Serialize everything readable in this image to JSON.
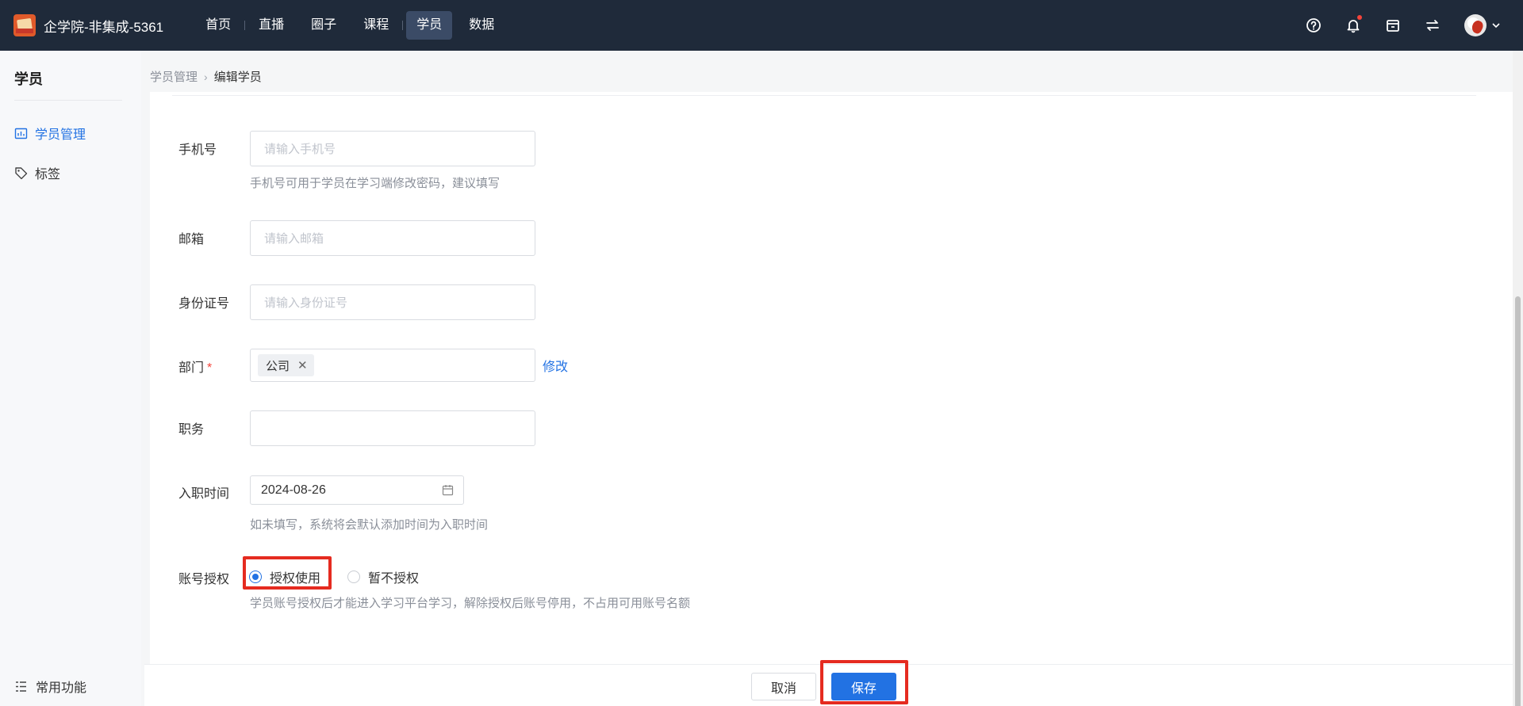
{
  "app": {
    "title": "企学院-非集成-5361"
  },
  "nav": {
    "items": [
      {
        "label": "首页"
      },
      {
        "label": "直播"
      },
      {
        "label": "圈子"
      },
      {
        "label": "课程"
      },
      {
        "label": "学员"
      },
      {
        "label": "数据"
      }
    ],
    "active": "学员"
  },
  "topbar_icons": [
    "help-icon",
    "bell-icon",
    "shop-icon",
    "switch-icon",
    "avatar"
  ],
  "sidebar": {
    "title": "学员",
    "items": [
      {
        "label": "学员管理",
        "icon": "chart-icon",
        "active": true
      },
      {
        "label": "标签",
        "icon": "tag-icon",
        "active": false
      }
    ],
    "footer_label": "常用功能"
  },
  "breadcrumb": {
    "parent": "学员管理",
    "current": "编辑学员"
  },
  "form": {
    "phone": {
      "label": "手机号",
      "placeholder": "请输入手机号",
      "hint": "手机号可用于学员在学习端修改密码，建议填写"
    },
    "email": {
      "label": "邮箱",
      "placeholder": "请输入邮箱"
    },
    "id_number": {
      "label": "身份证号",
      "placeholder": "请输入身份证号"
    },
    "department": {
      "label": "部门",
      "required_mark": "*",
      "tag": "公司",
      "tag_close": "✕",
      "edit_link": "修改"
    },
    "position": {
      "label": "职务",
      "value": ""
    },
    "join_date": {
      "label": "入职时间",
      "value": "2024-08-26",
      "hint": "如未填写，系统将会默认添加时间为入职时间"
    },
    "account_auth": {
      "label": "账号授权",
      "options": [
        {
          "label": "授权使用",
          "checked": true
        },
        {
          "label": "暂不授权",
          "checked": false
        }
      ],
      "hint": "学员账号授权后才能进入学习平台学习，解除授权后账号停用，不占用可用账号名额"
    }
  },
  "footer": {
    "cancel_label": "取消",
    "save_label": "保存"
  },
  "colors": {
    "topbar": "#1f2a3a",
    "accent": "#2272e3",
    "highlight": "#e52b20",
    "required": "#f5443a"
  }
}
